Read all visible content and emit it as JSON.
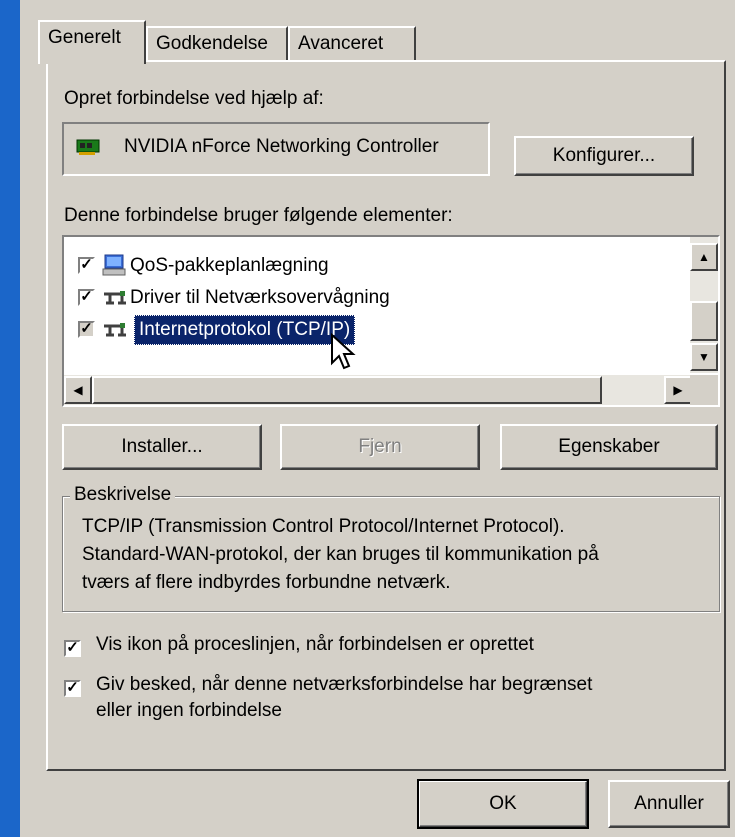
{
  "tabs": [
    "Generelt",
    "Godkendelse",
    "Avanceret"
  ],
  "connect_using_label": "Opret forbindelse ved hjælp af:",
  "adapter_name": "NVIDIA nForce Networking Controller",
  "configure_button": "Konfigurer...",
  "components_label": "Denne forbindelse bruger følgende elementer:",
  "components": [
    {
      "label": "QoS-pakkeplanlægning",
      "checked": true,
      "icon": "scheduler-icon"
    },
    {
      "label": "Driver til Netværksovervågning",
      "checked": true,
      "icon": "network-protocol-icon"
    },
    {
      "label": "Internetprotokol (TCP/IP)",
      "checked": true,
      "icon": "network-protocol-icon",
      "selected": true
    }
  ],
  "buttons": {
    "install": "Installer...",
    "remove": "Fjern",
    "properties": "Egenskaber"
  },
  "description": {
    "title": "Beskrivelse",
    "line1": "TCP/IP (Transmission Control Protocol/Internet Protocol).",
    "line2": "Standard-WAN-protokol, der kan bruges til kommunikation på",
    "line3": "tværs af flere indbyrdes forbundne netværk."
  },
  "options": {
    "show_icon": "Vis ikon på proceslinjen, når forbindelsen er oprettet",
    "notify_line1": "Giv besked, når denne netværksforbindelse har begrænset",
    "notify_line2": "eller ingen forbindelse"
  },
  "footer": {
    "ok": "OK",
    "cancel": "Annuller"
  },
  "colors": {
    "selection": "#0a246a",
    "desktop": "#1b66c9"
  }
}
